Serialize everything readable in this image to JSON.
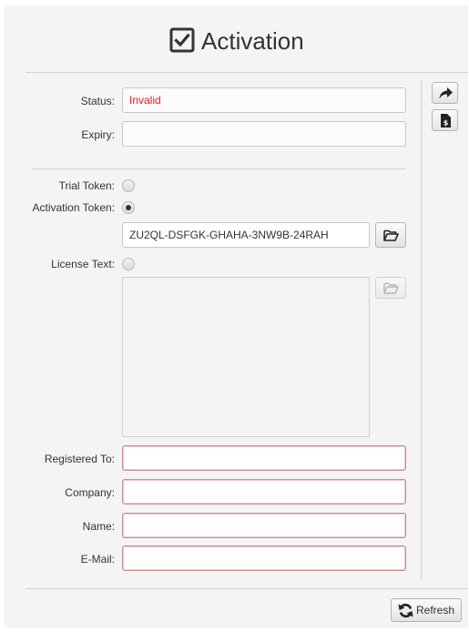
{
  "header": {
    "title": "Activation",
    "icon": "checkbox-checked-icon"
  },
  "status": {
    "label": "Status:",
    "value": "Invalid",
    "value_color": "#e02020"
  },
  "expiry": {
    "label": "Expiry:",
    "value": ""
  },
  "trial_token": {
    "label": "Trial Token:",
    "selected": false
  },
  "activation_token": {
    "label": "Activation Token:",
    "selected": true,
    "value": "ZU2QL-DSFGK-GHAHA-3NW9B-24RAH"
  },
  "license_text": {
    "label": "License Text:",
    "selected": false,
    "value": ""
  },
  "registered_to": {
    "label": "Registered To:",
    "value": ""
  },
  "company": {
    "label": "Company:",
    "value": ""
  },
  "name": {
    "label": "Name:",
    "value": ""
  },
  "email": {
    "label": "E-Mail:",
    "value": ""
  },
  "side_toolbar": {
    "buttons": [
      "share-arrow-icon",
      "clipboard-dollar-icon"
    ]
  },
  "footer": {
    "refresh_label": "Refresh",
    "refresh_icon": "refresh-icon"
  }
}
